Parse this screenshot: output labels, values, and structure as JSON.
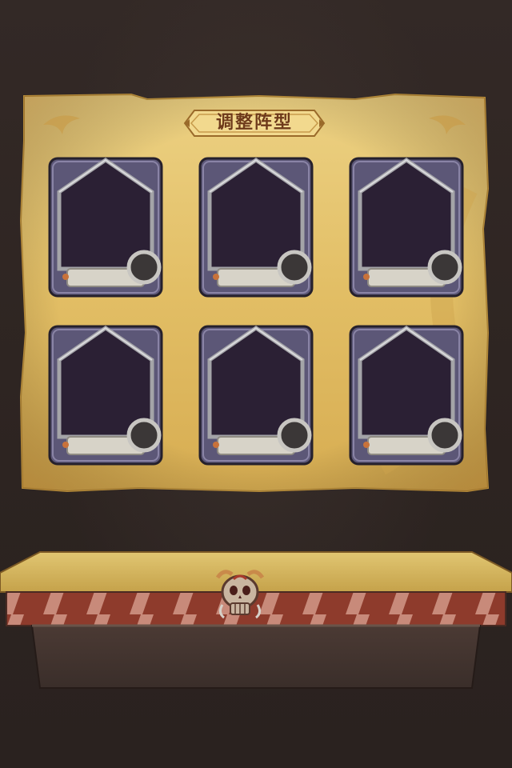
{
  "screen": {
    "title": "调整阵型"
  },
  "formation": {
    "slots": [
      {
        "id": "slot-1",
        "status": "empty"
      },
      {
        "id": "slot-2",
        "status": "empty"
      },
      {
        "id": "slot-3",
        "status": "empty"
      },
      {
        "id": "slot-4",
        "status": "empty"
      },
      {
        "id": "slot-5",
        "status": "empty"
      },
      {
        "id": "slot-6",
        "status": "empty"
      }
    ]
  },
  "colors": {
    "parchment": "#e2c06a",
    "slot_frame": "#5c5777",
    "slot_inner": "#2b2034",
    "title_text": "#6e3a1a",
    "tray_top": "#d2b35c",
    "tray_stripe_red": "#8e3b2c"
  },
  "icons": {
    "slot_badge": "circle-badge-icon",
    "tray_emblem": "skull-emblem-icon"
  }
}
